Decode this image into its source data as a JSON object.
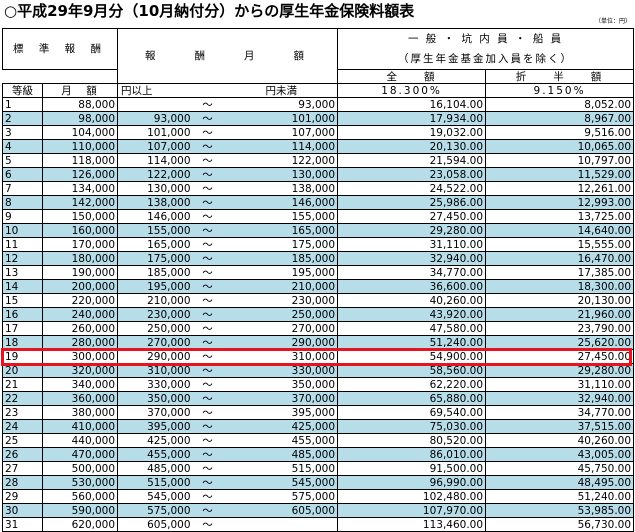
{
  "title": "○平成29年9月分（10月納付分）からの厚生年金保険料額表",
  "unit_note": "（単位：円）",
  "headers": {
    "standard_remuneration": "標 準 報 酬",
    "remuneration_monthly": "報　　酬　　月　　額",
    "category_line1": "一 般 ・ 坑 内 員 ・ 船 員",
    "category_line2": "（厚生年金基金加入員を除く）",
    "full_amount": "全　　額",
    "half_amount": "折　　半　　額",
    "grade": "等級",
    "monthly_amount": "月　額",
    "full_rate": "18.300%",
    "half_rate": "9.150%",
    "lower_bound": "円以上",
    "upper_bound": "円未満"
  },
  "tilde": "～",
  "rows": [
    {
      "grade": "1",
      "monthly": "88,000",
      "from": "",
      "to": "93,000",
      "full": "16,104.00",
      "half": "8,052.00"
    },
    {
      "grade": "2",
      "monthly": "98,000",
      "from": "93,000",
      "to": "101,000",
      "full": "17,934.00",
      "half": "8,967.00"
    },
    {
      "grade": "3",
      "monthly": "104,000",
      "from": "101,000",
      "to": "107,000",
      "full": "19,032.00",
      "half": "9,516.00"
    },
    {
      "grade": "4",
      "monthly": "110,000",
      "from": "107,000",
      "to": "114,000",
      "full": "20,130.00",
      "half": "10,065.00"
    },
    {
      "grade": "5",
      "monthly": "118,000",
      "from": "114,000",
      "to": "122,000",
      "full": "21,594.00",
      "half": "10,797.00"
    },
    {
      "grade": "6",
      "monthly": "126,000",
      "from": "122,000",
      "to": "130,000",
      "full": "23,058.00",
      "half": "11,529.00"
    },
    {
      "grade": "7",
      "monthly": "134,000",
      "from": "130,000",
      "to": "138,000",
      "full": "24,522.00",
      "half": "12,261.00"
    },
    {
      "grade": "8",
      "monthly": "142,000",
      "from": "138,000",
      "to": "146,000",
      "full": "25,986.00",
      "half": "12,993.00"
    },
    {
      "grade": "9",
      "monthly": "150,000",
      "from": "146,000",
      "to": "155,000",
      "full": "27,450.00",
      "half": "13,725.00"
    },
    {
      "grade": "10",
      "monthly": "160,000",
      "from": "155,000",
      "to": "165,000",
      "full": "29,280.00",
      "half": "14,640.00"
    },
    {
      "grade": "11",
      "monthly": "170,000",
      "from": "165,000",
      "to": "175,000",
      "full": "31,110.00",
      "half": "15,555.00"
    },
    {
      "grade": "12",
      "monthly": "180,000",
      "from": "175,000",
      "to": "185,000",
      "full": "32,940.00",
      "half": "16,470.00"
    },
    {
      "grade": "13",
      "monthly": "190,000",
      "from": "185,000",
      "to": "195,000",
      "full": "34,770.00",
      "half": "17,385.00"
    },
    {
      "grade": "14",
      "monthly": "200,000",
      "from": "195,000",
      "to": "210,000",
      "full": "36,600.00",
      "half": "18,300.00"
    },
    {
      "grade": "15",
      "monthly": "220,000",
      "from": "210,000",
      "to": "230,000",
      "full": "40,260.00",
      "half": "20,130.00"
    },
    {
      "grade": "16",
      "monthly": "240,000",
      "from": "230,000",
      "to": "250,000",
      "full": "43,920.00",
      "half": "21,960.00"
    },
    {
      "grade": "17",
      "monthly": "260,000",
      "from": "250,000",
      "to": "270,000",
      "full": "47,580.00",
      "half": "23,790.00"
    },
    {
      "grade": "18",
      "monthly": "280,000",
      "from": "270,000",
      "to": "290,000",
      "full": "51,240.00",
      "half": "25,620.00"
    },
    {
      "grade": "19",
      "monthly": "300,000",
      "from": "290,000",
      "to": "310,000",
      "full": "54,900.00",
      "half": "27,450.00"
    },
    {
      "grade": "20",
      "monthly": "320,000",
      "from": "310,000",
      "to": "330,000",
      "full": "58,560.00",
      "half": "29,280.00"
    },
    {
      "grade": "21",
      "monthly": "340,000",
      "from": "330,000",
      "to": "350,000",
      "full": "62,220.00",
      "half": "31,110.00"
    },
    {
      "grade": "22",
      "monthly": "360,000",
      "from": "350,000",
      "to": "370,000",
      "full": "65,880.00",
      "half": "32,940.00"
    },
    {
      "grade": "23",
      "monthly": "380,000",
      "from": "370,000",
      "to": "395,000",
      "full": "69,540.00",
      "half": "34,770.00"
    },
    {
      "grade": "24",
      "monthly": "410,000",
      "from": "395,000",
      "to": "425,000",
      "full": "75,030.00",
      "half": "37,515.00"
    },
    {
      "grade": "25",
      "monthly": "440,000",
      "from": "425,000",
      "to": "455,000",
      "full": "80,520.00",
      "half": "40,260.00"
    },
    {
      "grade": "26",
      "monthly": "470,000",
      "from": "455,000",
      "to": "485,000",
      "full": "86,010.00",
      "half": "43,005.00"
    },
    {
      "grade": "27",
      "monthly": "500,000",
      "from": "485,000",
      "to": "515,000",
      "full": "91,500.00",
      "half": "45,750.00"
    },
    {
      "grade": "28",
      "monthly": "530,000",
      "from": "515,000",
      "to": "545,000",
      "full": "96,990.00",
      "half": "48,495.00"
    },
    {
      "grade": "29",
      "monthly": "560,000",
      "from": "545,000",
      "to": "575,000",
      "full": "102,480.00",
      "half": "51,240.00"
    },
    {
      "grade": "30",
      "monthly": "590,000",
      "from": "575,000",
      "to": "605,000",
      "full": "107,970.00",
      "half": "53,985.00"
    },
    {
      "grade": "31",
      "monthly": "620,000",
      "from": "605,000",
      "to": "",
      "full": "113,460.00",
      "half": "56,730.00"
    }
  ],
  "highlight_grade": "19",
  "highlight_color": "#e8131f",
  "alt_row_color": "#b7dde8"
}
